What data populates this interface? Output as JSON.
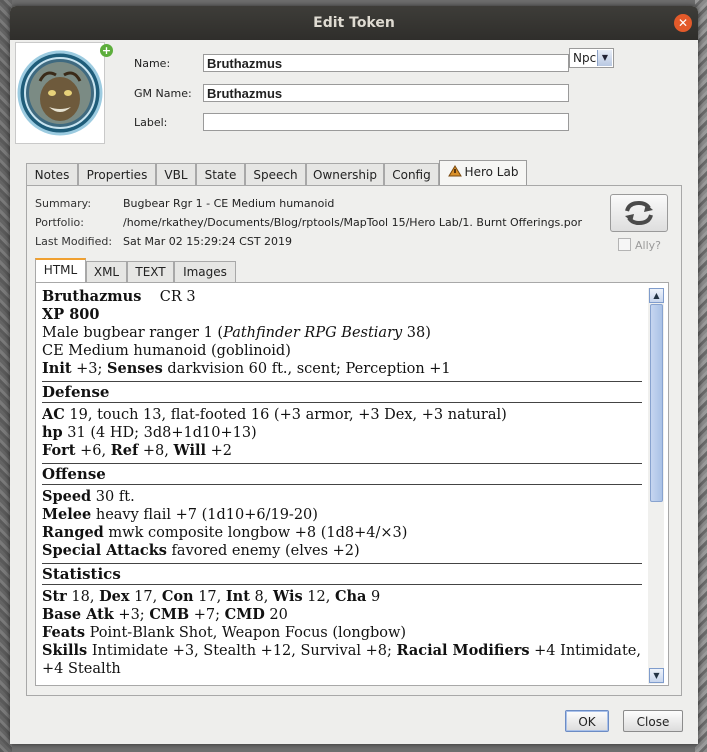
{
  "window": {
    "title": "Edit Token"
  },
  "fields": {
    "name_label": "Name:",
    "name_value": "Bruthazmus",
    "gm_name_label": "GM Name:",
    "gm_name_value": "Bruthazmus",
    "label_label": "Label:",
    "label_value": "",
    "type_select": "Npc"
  },
  "tabs": [
    {
      "label": "Notes"
    },
    {
      "label": "Properties"
    },
    {
      "label": "VBL"
    },
    {
      "label": "State"
    },
    {
      "label": "Speech"
    },
    {
      "label": "Ownership"
    },
    {
      "label": "Config"
    },
    {
      "label": "Hero Lab",
      "active": true
    }
  ],
  "herolab": {
    "summary_label": "Summary:",
    "summary_value": "Bugbear Rgr 1 - CE Medium humanoid",
    "portfolio_label": "Portfolio:",
    "portfolio_value": "/home/rkathey/Documents/Blog/rptools/MapTool 15/Hero Lab/1. Burnt Offerings.por",
    "modified_label": "Last Modified:",
    "modified_value": "Sat Mar 02 15:29:24 CST 2019",
    "ally_label": "Ally?",
    "ally_checked": false
  },
  "subtabs": [
    {
      "label": "HTML",
      "active": true
    },
    {
      "label": "XML"
    },
    {
      "label": "TEXT"
    },
    {
      "label": "Images"
    }
  ],
  "statblock": {
    "name": "Bruthazmus",
    "cr": "CR 3",
    "xp": "XP 800",
    "line_race_a": "Male bugbear ranger 1 (",
    "line_race_src": "Pathfinder RPG Bestiary",
    "line_race_b": " 38)",
    "line_type": "CE Medium humanoid (goblinoid)",
    "init_label": "Init",
    "init_value": " +3; ",
    "senses_label": "Senses",
    "senses_value": " darkvision 60 ft., scent; Perception +1",
    "defense_header": "Defense",
    "ac_label": "AC",
    "ac_value": " 19, touch 13, flat-footed 16 (+3 armor, +3 Dex, +3 natural)",
    "hp_label": "hp",
    "hp_value": " 31 (4 HD; 3d8+1d10+13)",
    "fort_label": "Fort",
    "fort_value": " +6, ",
    "ref_label": "Ref",
    "ref_value": " +8, ",
    "will_label": "Will",
    "will_value": " +2",
    "offense_header": "Offense",
    "speed_label": "Speed",
    "speed_value": " 30 ft.",
    "melee_label": "Melee",
    "melee_value": " heavy flail +7 (1d10+6/19-20)",
    "ranged_label": "Ranged",
    "ranged_value": " mwk composite longbow +8 (1d8+4/×3)",
    "special_label": "Special Attacks",
    "special_value": " favored enemy (elves +2)",
    "statistics_header": "Statistics",
    "str_label": "Str",
    "str_value": " 18, ",
    "dex_label": "Dex",
    "dex_value": " 17, ",
    "con_label": "Con",
    "con_value": " 17, ",
    "int_label": "Int",
    "int_value": " 8, ",
    "wis_label": "Wis",
    "wis_value": " 12, ",
    "cha_label": "Cha",
    "cha_value": " 9",
    "bab_label": "Base Atk",
    "bab_value": " +3; ",
    "cmb_label": "CMB",
    "cmb_value": " +7; ",
    "cmd_label": "CMD",
    "cmd_value": " 20",
    "feats_label": "Feats",
    "feats_value": " Point-Blank Shot, Weapon Focus (longbow)",
    "skills_label": "Skills",
    "skills_value": " Intimidate +3, Stealth +12, Survival +8; ",
    "racial_label": "Racial Modifiers",
    "racial_value": " +4 Intimidate,",
    "skills_cont": "+4 Stealth"
  },
  "buttons": {
    "ok": "OK",
    "close": "Close"
  },
  "colors": {
    "accent": "#f0a030",
    "titlebar": "#33322e",
    "close": "#e35a2a"
  },
  "icons": {
    "refresh": "refresh-arrows-icon",
    "herolab_tab": "warning-triangle-icon",
    "add": "plus-icon"
  }
}
